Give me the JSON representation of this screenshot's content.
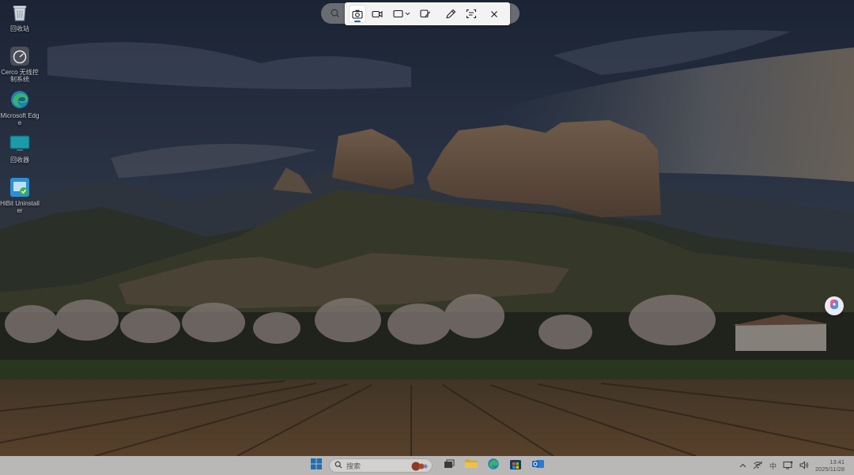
{
  "desktop": {
    "icons": [
      {
        "label": "回收站",
        "icon": "recycle-bin-icon"
      },
      {
        "label": "Cerco 无线控制系统",
        "icon": "gauge-app-icon"
      },
      {
        "label": "Microsoft Edge",
        "icon": "edge-icon"
      },
      {
        "label": "回收器",
        "icon": "monitor-icon"
      },
      {
        "label": "HiBit Uninstaller",
        "icon": "hibit-uninstaller-icon"
      }
    ]
  },
  "snipping_toolbar": {
    "tools": [
      {
        "name": "screenshot-mode",
        "icon": "camera-icon",
        "active": true
      },
      {
        "name": "record-mode",
        "icon": "video-camera-icon",
        "active": false
      },
      {
        "name": "rectangle-mode",
        "icon": "rectangle-icon",
        "active": false
      },
      {
        "name": "edit-snip",
        "icon": "image-edit-icon",
        "active": false
      },
      {
        "name": "draw",
        "icon": "pen-icon",
        "active": false
      },
      {
        "name": "text-actions",
        "icon": "text-extract-icon",
        "active": false
      },
      {
        "name": "close",
        "icon": "close-icon",
        "active": false
      }
    ],
    "search_icon": "search-icon",
    "accent": "#0067c0"
  },
  "taskbar": {
    "search_placeholder": "搜索",
    "apps": [
      {
        "name": "task-view",
        "icon": "task-view-icon"
      },
      {
        "name": "file-explorer",
        "icon": "folder-icon"
      },
      {
        "name": "edge",
        "icon": "edge-icon"
      },
      {
        "name": "microsoft-store",
        "icon": "store-icon"
      },
      {
        "name": "outlook",
        "icon": "outlook-icon"
      }
    ],
    "tray": {
      "chevron": "^",
      "ime": "中",
      "time": "13:41",
      "date": "2025/11/28"
    }
  }
}
